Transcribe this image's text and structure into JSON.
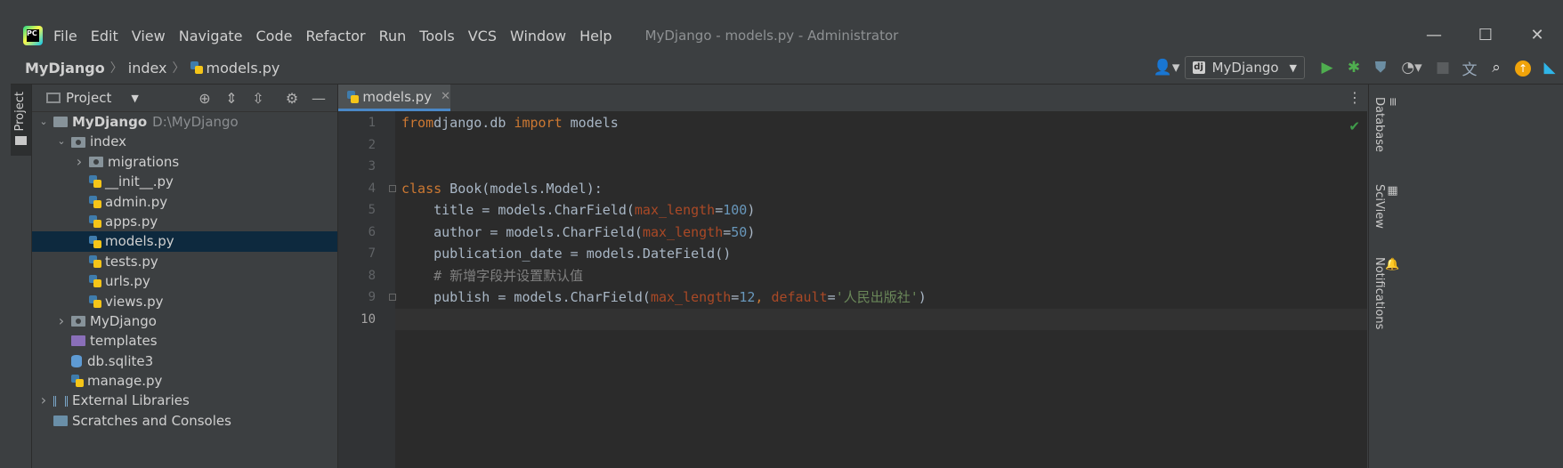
{
  "app": {
    "logo": "PC",
    "menu": [
      "File",
      "Edit",
      "View",
      "Navigate",
      "Code",
      "Refactor",
      "Run",
      "Tools",
      "VCS",
      "Window",
      "Help"
    ],
    "title": "MyDjango - models.py - Administrator"
  },
  "window_controls": {
    "minimize": "—",
    "maximize": "☐",
    "close": "✕"
  },
  "breadcrumb": {
    "project": "MyDjango",
    "folder": "index",
    "file": "models.py"
  },
  "run_config": {
    "label": "MyDjango",
    "icon_letter": "dj"
  },
  "toolbar_icons": [
    "user-icon",
    "run-icon",
    "debug-icon",
    "coverage-icon",
    "profile-icon",
    "stop-icon",
    "translate-icon",
    "search-icon",
    "update-icon",
    "jetbrains-icon"
  ],
  "project_panel": {
    "title": "Project",
    "tree": [
      {
        "label": "MyDjango",
        "path": "D:\\MyDjango",
        "depth": 0,
        "expanded": true,
        "type": "folder"
      },
      {
        "label": "index",
        "depth": 1,
        "expanded": true,
        "type": "package"
      },
      {
        "label": "migrations",
        "depth": 2,
        "expanded": false,
        "type": "package"
      },
      {
        "label": "__init__.py",
        "depth": 2,
        "type": "py"
      },
      {
        "label": "admin.py",
        "depth": 2,
        "type": "py"
      },
      {
        "label": "apps.py",
        "depth": 2,
        "type": "py"
      },
      {
        "label": "models.py",
        "depth": 2,
        "type": "py",
        "selected": true
      },
      {
        "label": "tests.py",
        "depth": 2,
        "type": "py"
      },
      {
        "label": "urls.py",
        "depth": 2,
        "type": "py"
      },
      {
        "label": "views.py",
        "depth": 2,
        "type": "py"
      },
      {
        "label": "MyDjango",
        "depth": 1,
        "expanded": false,
        "type": "package"
      },
      {
        "label": "templates",
        "depth": 1,
        "type": "folder-purple"
      },
      {
        "label": "db.sqlite3",
        "depth": 1,
        "type": "db"
      },
      {
        "label": "manage.py",
        "depth": 1,
        "type": "py"
      },
      {
        "label": "External Libraries",
        "depth": 0,
        "expanded": false,
        "type": "lib"
      },
      {
        "label": "Scratches and Consoles",
        "depth": 0,
        "type": "scratch"
      }
    ]
  },
  "editor": {
    "tab": "models.py",
    "current_line": 10,
    "lines": [
      [
        [
          "kw",
          "from"
        ],
        [
          "",
          "django.db "
        ],
        [
          "kw",
          "import"
        ],
        [
          "",
          " models"
        ]
      ],
      [],
      [],
      [
        [
          "kw",
          "class"
        ],
        [
          "",
          " Book(models.Model):"
        ]
      ],
      [
        [
          "",
          "    title = models.CharField("
        ],
        [
          "prm",
          "max_length"
        ],
        [
          "",
          "="
        ],
        [
          "num",
          "100"
        ],
        [
          "",
          ")"
        ]
      ],
      [
        [
          "",
          "    author = models.CharField("
        ],
        [
          "prm",
          "max_length"
        ],
        [
          "",
          "="
        ],
        [
          "num",
          "50"
        ],
        [
          "",
          ")"
        ]
      ],
      [
        [
          "",
          "    publication_date = models.DateField()"
        ]
      ],
      [
        [
          "cmt",
          "    # 新增字段并设置默认值"
        ]
      ],
      [
        [
          "",
          "    publish = models.CharField("
        ],
        [
          "prm",
          "max_length"
        ],
        [
          "",
          "="
        ],
        [
          "num",
          "12"
        ],
        [
          "kw",
          ", "
        ],
        [
          "prm",
          "default"
        ],
        [
          "",
          "="
        ],
        [
          "str",
          "'人民出版社'"
        ],
        [
          "",
          ")"
        ]
      ],
      []
    ]
  },
  "left_strip": {
    "tab": "Project"
  },
  "right_strip": {
    "tabs": [
      "Database",
      "SciView",
      "Notifications"
    ]
  }
}
